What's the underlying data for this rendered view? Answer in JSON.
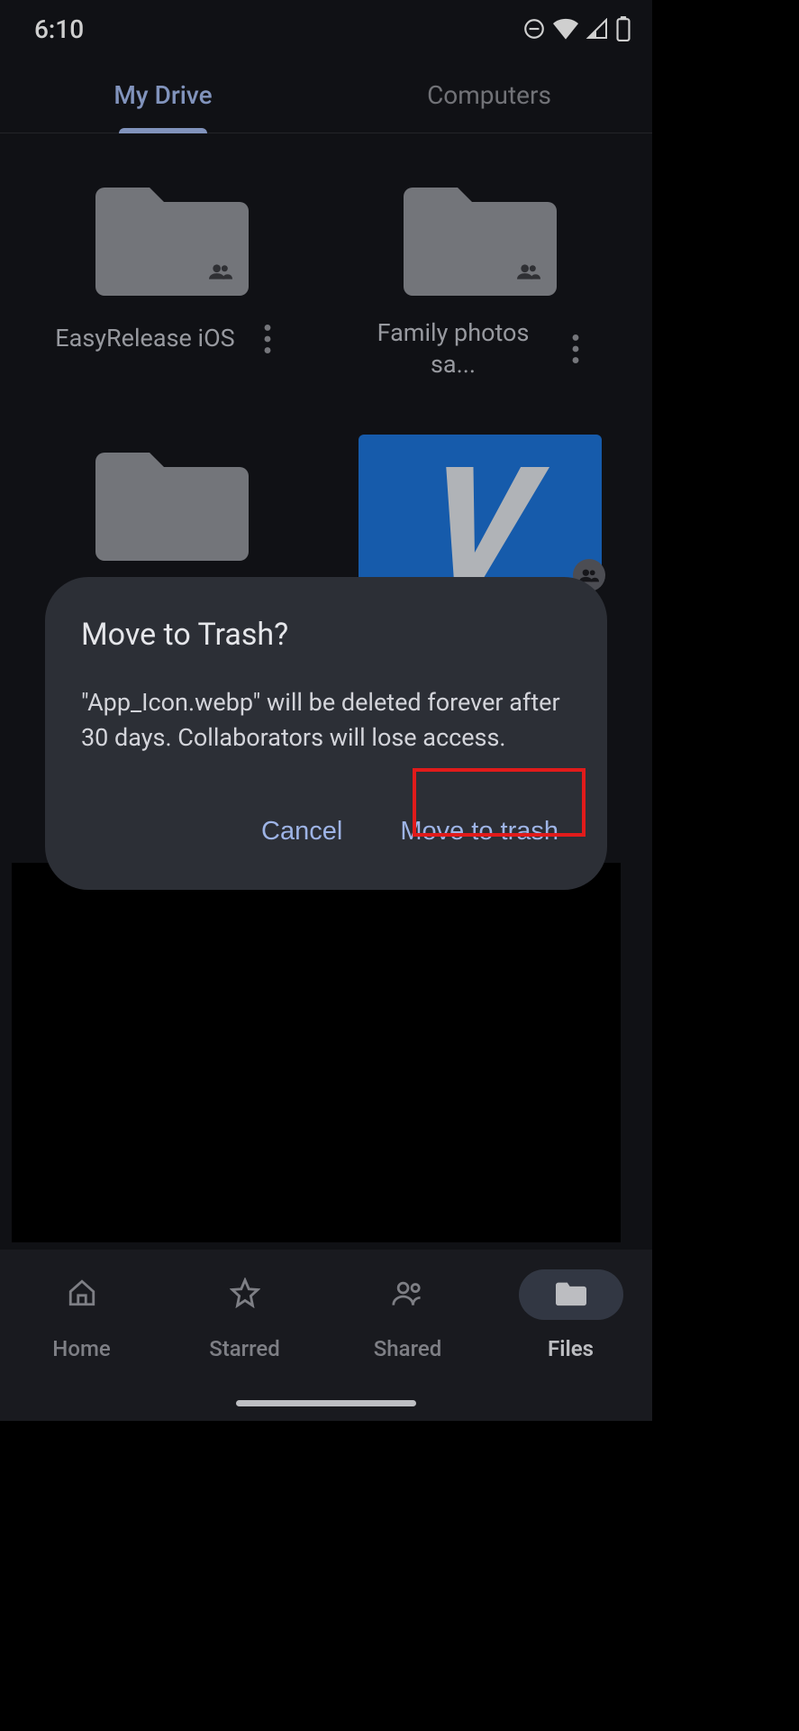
{
  "statusbar": {
    "time": "6:10"
  },
  "tabs": {
    "my_drive": "My Drive",
    "computers": "Computers"
  },
  "items": [
    {
      "name": "EasyRelease iOS"
    },
    {
      "name": "Family photos sa..."
    }
  ],
  "dialog": {
    "title": "Move to Trash?",
    "message": "\"App_Icon.webp\" will be deleted forever after 30 days. Collaborators will lose access.",
    "cancel": "Cancel",
    "confirm": "Move to trash"
  },
  "bottomnav": {
    "home": "Home",
    "starred": "Starred",
    "shared": "Shared",
    "files": "Files"
  }
}
